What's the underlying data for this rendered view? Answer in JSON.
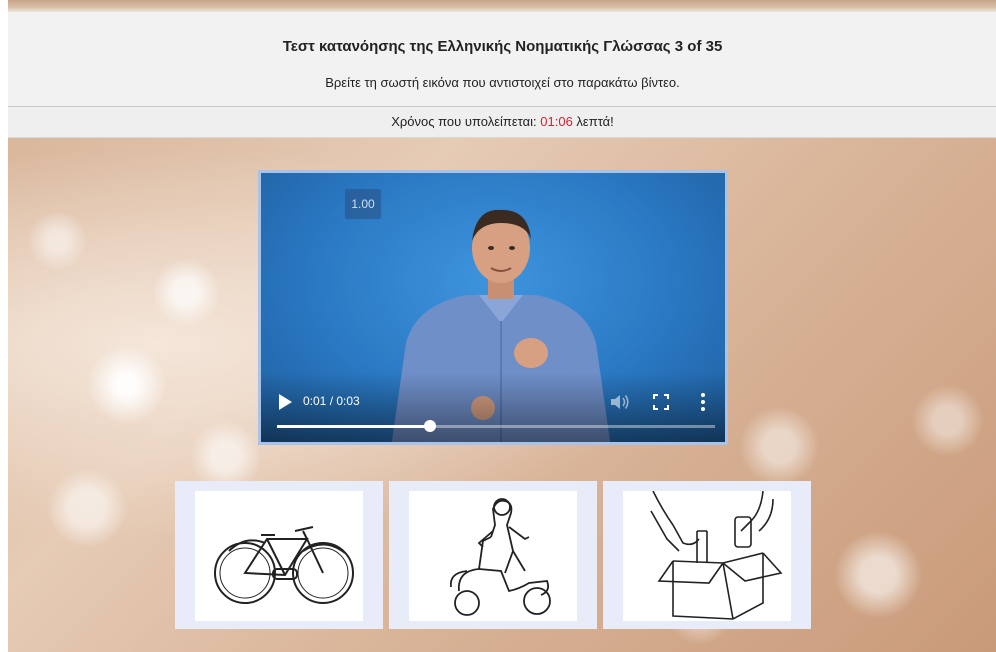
{
  "header": {
    "title": "Τεστ κατανόησης της Ελληνικής Νοηματικής Γλώσσας 3 of 35",
    "subtitle": "Βρείτε τη σωστή εικόνα που αντιστοιχεί στο παρακάτω βίντεο."
  },
  "timer": {
    "prefix": "Χρόνος που υπολείπεται: ",
    "value": "01:06",
    "suffix": " λεπτά!"
  },
  "video": {
    "speed": "1.00",
    "time": "0:01 / 0:03",
    "progress_percent": 35,
    "icons": [
      "play-icon",
      "volume-icon",
      "fullscreen-icon",
      "more-options-icon"
    ]
  },
  "choices": [
    {
      "icon": "bicycle-illustration"
    },
    {
      "icon": "scooter-rider-illustration"
    },
    {
      "icon": "box-packing-illustration"
    }
  ],
  "colors": {
    "timer_value": "#d0222f",
    "video_border": "#a9c3e8",
    "choice_frame": "#e7ecf8"
  }
}
